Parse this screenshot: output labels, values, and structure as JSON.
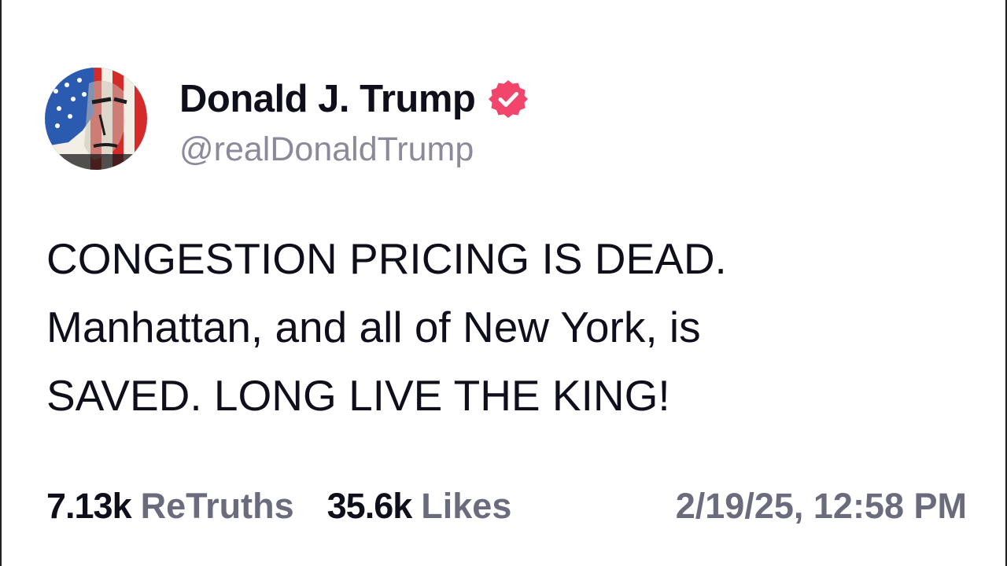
{
  "profile": {
    "display_name": "Donald J. Trump",
    "handle": "@realDonaldTrump",
    "verified_icon": "verified-badge-icon",
    "avatar_icon": "profile-avatar-flag-portrait"
  },
  "post": {
    "lines": [
      "CONGESTION PRICING IS DEAD.",
      "Manhattan, and all of New York, is",
      "SAVED. LONG LIVE THE KING!"
    ]
  },
  "stats": {
    "retruths_count": "7.13k",
    "retruths_label": "ReTruths",
    "likes_count": "35.6k",
    "likes_label": "Likes",
    "timestamp": "2/19/25, 12:58 PM"
  },
  "colors": {
    "text_primary": "#0f0f1c",
    "text_secondary": "#6b6b7e",
    "handle": "#8a8a9a",
    "verified_badge": "#f2456b",
    "background": "#ffffff"
  }
}
